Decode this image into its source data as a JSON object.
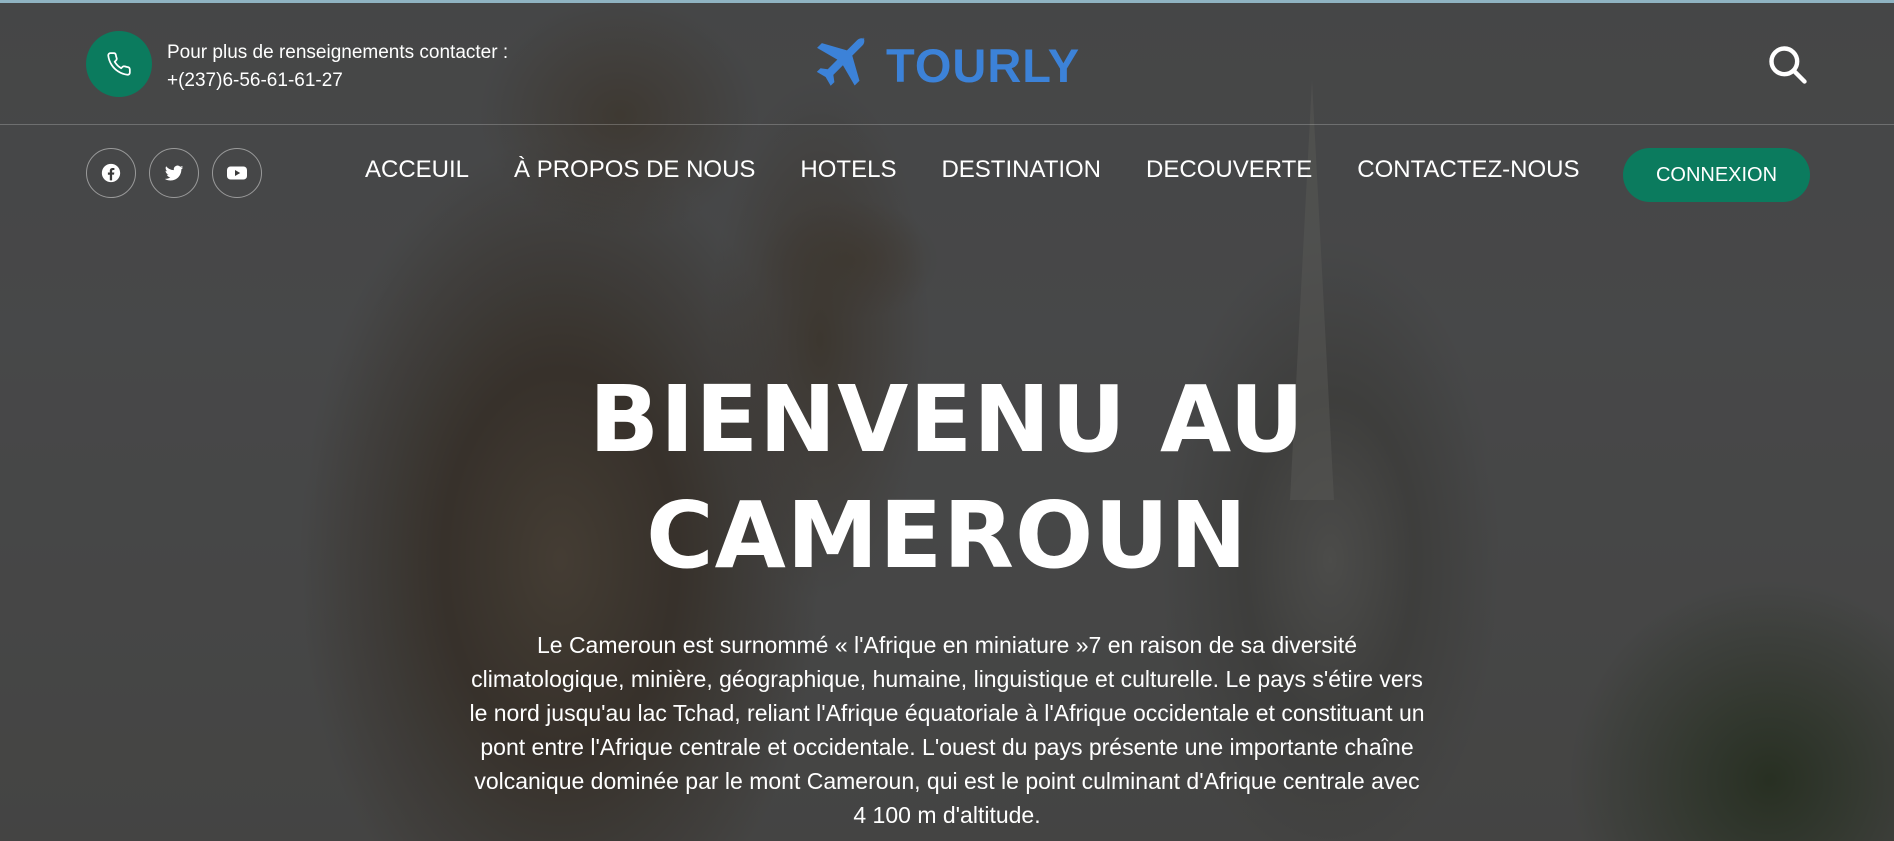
{
  "header": {
    "contact_label": "Pour plus de renseignements contacter :",
    "contact_phone": "+(237)6-56-61-61-27",
    "phone_icon": "phone-icon",
    "logo_icon": "airplane-icon",
    "logo_text": "TOURLY",
    "search_icon": "search-icon"
  },
  "nav": {
    "social": [
      {
        "icon": "facebook-icon"
      },
      {
        "icon": "twitter-icon"
      },
      {
        "icon": "youtube-icon"
      }
    ],
    "links": [
      "ACCEUIL",
      "À PROPOS DE NOUS",
      "HOTELS",
      "DESTINATION",
      "DECOUVERTE",
      "CONTACTEZ-NOUS"
    ],
    "cta_label": "CONNEXION"
  },
  "hero": {
    "title_line1": "BIENVENU AU",
    "title_line2": "CAMEROUN",
    "desc_lines": [
      "Le Cameroun est surnommé « l'Afrique en miniature »7 en raison de sa diversité",
      "climatologique, minière, géographique, humaine, linguistique et culturelle. Le pays s'étire vers",
      "le nord jusqu'au lac Tchad, reliant l'Afrique équatoriale à l'Afrique occidentale et constituant un",
      "pont entre l'Afrique centrale et occidentale. L'ouest du pays présente une importante chaîne",
      "volcanique dominée par le mont Cameroun, qui est le point culminant d'Afrique centrale avec",
      "4 100 m d'altitude."
    ]
  },
  "colors": {
    "accent_green": "#0b7b5e",
    "logo_blue": "#3c82d8",
    "text": "#ffffff"
  }
}
